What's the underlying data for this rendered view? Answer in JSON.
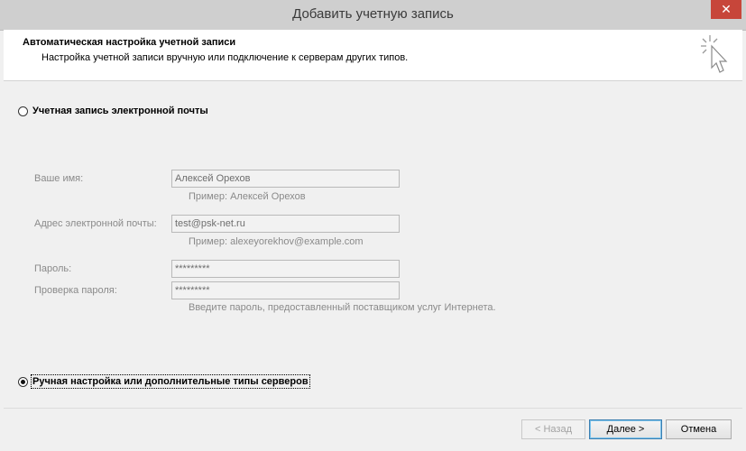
{
  "window": {
    "title": "Добавить учетную запись",
    "close_label": "✕"
  },
  "header": {
    "title": "Автоматическая настройка учетной записи",
    "subtitle": "Настройка учетной записи вручную или подключение к серверам других типов."
  },
  "options": {
    "email_account": {
      "label": "Учетная запись электронной почты",
      "selected": false
    },
    "manual_setup": {
      "label": "Ручная настройка или дополнительные типы серверов",
      "selected": true
    }
  },
  "form": {
    "name": {
      "label": "Ваше имя:",
      "value": "Алексей Орехов",
      "hint": "Пример: Алексей Орехов"
    },
    "email": {
      "label": "Адрес электронной почты:",
      "value": "test@psk-net.ru",
      "hint": "Пример: alexeyorekhov@example.com"
    },
    "password": {
      "label": "Пароль:",
      "value": "*********"
    },
    "password_confirm": {
      "label": "Проверка пароля:",
      "value": "*********"
    },
    "password_hint": "Введите пароль, предоставленный поставщиком услуг Интернета."
  },
  "buttons": {
    "back": "< Назад",
    "next": "Далее >",
    "cancel": "Отмена"
  }
}
